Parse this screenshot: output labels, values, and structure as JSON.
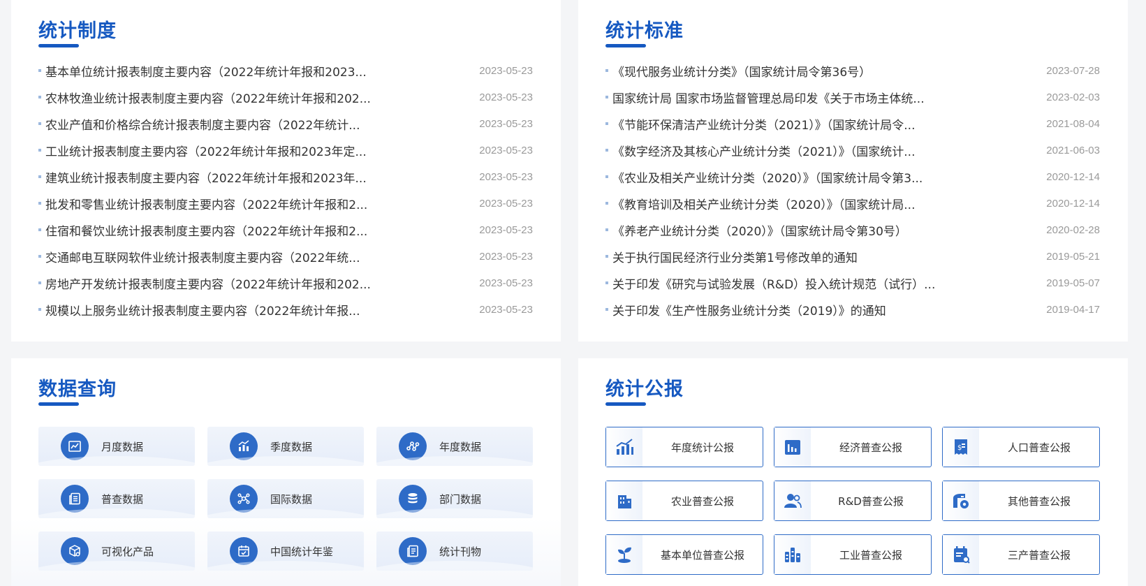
{
  "zhidu": {
    "title": "统计制度",
    "items": [
      {
        "title": "基本单位统计报表制度主要内容（2022年统计年报和2023...",
        "date": "2023-05-23"
      },
      {
        "title": "农林牧渔业统计报表制度主要内容（2022年统计年报和202...",
        "date": "2023-05-23"
      },
      {
        "title": "农业产值和价格综合统计报表制度主要内容（2022年统计...",
        "date": "2023-05-23"
      },
      {
        "title": "工业统计报表制度主要内容（2022年统计年报和2023年定...",
        "date": "2023-05-23"
      },
      {
        "title": "建筑业统计报表制度主要内容（2022年统计年报和2023年...",
        "date": "2023-05-23"
      },
      {
        "title": "批发和零售业统计报表制度主要内容（2022年统计年报和2...",
        "date": "2023-05-23"
      },
      {
        "title": "住宿和餐饮业统计报表制度主要内容（2022年统计年报和2...",
        "date": "2023-05-23"
      },
      {
        "title": "交通邮电互联网软件业统计报表制度主要内容（2022年统...",
        "date": "2023-05-23"
      },
      {
        "title": "房地产开发统计报表制度主要内容（2022年统计年报和202...",
        "date": "2023-05-23"
      },
      {
        "title": "规模以上服务业统计报表制度主要内容（2022年统计年报...",
        "date": "2023-05-23"
      }
    ]
  },
  "biaozhun": {
    "title": "统计标准",
    "items": [
      {
        "title": "《现代服务业统计分类》（国家统计局令第36号）",
        "date": "2023-07-28"
      },
      {
        "title": "国家统计局 国家市场监督管理总局印发《关于市场主体统...",
        "date": "2023-02-03"
      },
      {
        "title": "《节能环保清洁产业统计分类（2021）》（国家统计局令...",
        "date": "2021-08-04"
      },
      {
        "title": "《数字经济及其核心产业统计分类（2021）》（国家统计...",
        "date": "2021-06-03"
      },
      {
        "title": "《农业及相关产业统计分类（2020）》（国家统计局令第3...",
        "date": "2020-12-14"
      },
      {
        "title": "《教育培训及相关产业统计分类（2020）》（国家统计局...",
        "date": "2020-12-14"
      },
      {
        "title": "《养老产业统计分类（2020）》（国家统计局令第30号）",
        "date": "2020-02-28"
      },
      {
        "title": "关于执行国民经济行业分类第1号修改单的通知",
        "date": "2019-05-21"
      },
      {
        "title": "关于印发《研究与试验发展（R&D）投入统计规范（试行）...",
        "date": "2019-05-07"
      },
      {
        "title": "关于印发《生产性服务业统计分类（2019）》的通知",
        "date": "2019-04-17"
      }
    ]
  },
  "chaxun": {
    "title": "数据查询",
    "items": [
      {
        "label": "月度数据",
        "icon": "line-chart-icon"
      },
      {
        "label": "季度数据",
        "icon": "bar-trend-icon"
      },
      {
        "label": "年度数据",
        "icon": "nodes-icon"
      },
      {
        "label": "普查数据",
        "icon": "document-list-icon"
      },
      {
        "label": "国际数据",
        "icon": "network-icon"
      },
      {
        "label": "部门数据",
        "icon": "database-icon"
      },
      {
        "label": "可视化产品",
        "icon": "cube-icon"
      },
      {
        "label": "中国统计年鉴",
        "icon": "calendar-check-icon"
      },
      {
        "label": "统计刊物",
        "icon": "publication-icon"
      }
    ]
  },
  "gongbao": {
    "title": "统计公报",
    "items": [
      {
        "label": "年度统计公报",
        "icon": "bar-growth-icon"
      },
      {
        "label": "经济普查公报",
        "icon": "bar-chart-icon"
      },
      {
        "label": "人口普查公报",
        "icon": "receipt-icon"
      },
      {
        "label": "农业普查公报",
        "icon": "building-icon"
      },
      {
        "label": "R&D普查公报",
        "icon": "people-icon"
      },
      {
        "label": "其他普查公报",
        "icon": "factory-gear-icon"
      },
      {
        "label": "基本单位普查公报",
        "icon": "sprout-icon"
      },
      {
        "label": "工业普查公报",
        "icon": "battery-bars-icon"
      },
      {
        "label": "三产普查公报",
        "icon": "calendar-search-icon"
      }
    ]
  },
  "colors": {
    "accent": "#1659c1",
    "icon_blue": "#2e6bc7",
    "date_gray": "#9a9a9a"
  }
}
